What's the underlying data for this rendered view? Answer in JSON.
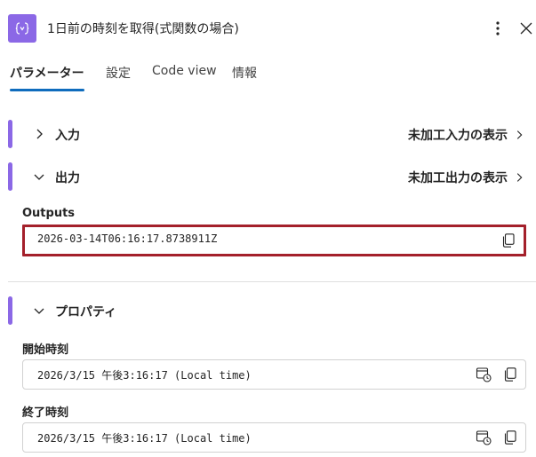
{
  "header": {
    "title": "1日前の時刻を取得(式関数の場合)",
    "icon": "expression-icon",
    "more_icon": "more-vertical-icon",
    "close_icon": "close-icon"
  },
  "tabs": [
    {
      "label": "パラメーター",
      "active": true
    },
    {
      "label": "設定",
      "active": false
    },
    {
      "label": "Code view",
      "active": false
    },
    {
      "label": "情報",
      "active": false
    }
  ],
  "sections": {
    "input": {
      "label": "入力",
      "raw_link": "未加工入力の表示",
      "expanded": false
    },
    "output": {
      "label": "出力",
      "raw_link": "未加工出力の表示",
      "expanded": true
    },
    "properties": {
      "label": "プロパティ",
      "expanded": true
    }
  },
  "outputs": {
    "label": "Outputs",
    "value": "2026-03-14T06:16:17.8738911Z"
  },
  "properties": {
    "start": {
      "label": "開始時刻",
      "value": "2026/3/15 午後3:16:17 (Local time)"
    },
    "end": {
      "label": "終了時刻",
      "value": "2026/3/15 午後3:16:17 (Local time)"
    }
  },
  "colors": {
    "accent": "#8b68e6",
    "tab_underline": "#0f6cbd",
    "highlight_border": "#a4202b"
  }
}
